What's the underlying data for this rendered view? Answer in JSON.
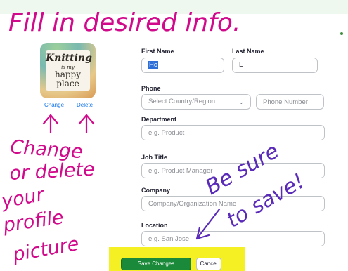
{
  "annotations": {
    "title": "Fill in desired info.",
    "left_note": [
      "Change",
      "or delete",
      "your",
      "profile",
      "picture"
    ],
    "right_note": [
      "Be sure",
      "to save!"
    ],
    "ink_color": "#d10a8c",
    "save_ink_color": "#5a2bb8"
  },
  "avatar": {
    "lines": [
      "Knitting",
      "is my",
      "happy",
      "place"
    ],
    "change_label": "Change",
    "delete_label": "Delete"
  },
  "form": {
    "first_name": {
      "label": "First Name",
      "value": "Ho"
    },
    "last_name": {
      "label": "Last Name",
      "value": "L"
    },
    "phone": {
      "label": "Phone",
      "country_placeholder": "Select Country/Region",
      "number_placeholder": "Phone Number"
    },
    "department": {
      "label": "Department",
      "placeholder": "e.g. Product"
    },
    "job_title": {
      "label": "Job Title",
      "placeholder": "e.g. Product Manager"
    },
    "company": {
      "label": "Company",
      "placeholder": "Company/Organization Name"
    },
    "location": {
      "label": "Location",
      "placeholder": "e.g. San Jose"
    }
  },
  "actions": {
    "save_label": "Save Changes",
    "cancel_label": "Cancel"
  },
  "colors": {
    "save_button": "#1a8a3a",
    "highlight": "#f4f024",
    "link": "#0e72ed"
  }
}
